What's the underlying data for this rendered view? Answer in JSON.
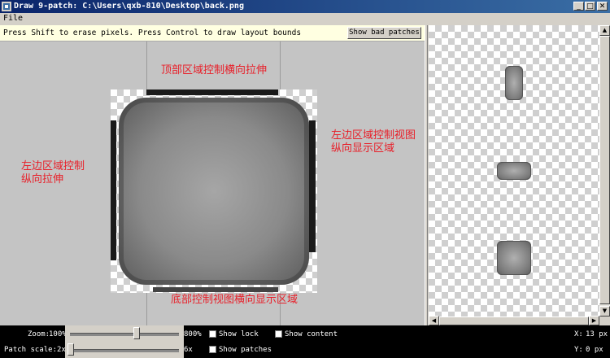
{
  "window": {
    "title": "Draw 9-patch: C:\\Users\\qxb-810\\Desktop\\back.png"
  },
  "controls": {
    "minimize": "_",
    "maximize": "□",
    "close": "✕"
  },
  "menu": {
    "items": [
      "File"
    ]
  },
  "hint": {
    "text": "Press Shift to erase pixels. Press Control to draw layout bounds"
  },
  "toolbar": {
    "show_bad_patches": "Show bad patches"
  },
  "annotations": {
    "top": "顶部区域控制横向拉伸",
    "left_line1": "左边区域控制",
    "left_line2": "纵向拉伸",
    "right_line1": "左边区域控制视图",
    "right_line2": "纵向显示区域",
    "bottom": "底部控制视图横向显示区域"
  },
  "footer": {
    "zoom_label": "Zoom:",
    "zoom_min": "100%",
    "zoom_max": "800%",
    "zoom_level": 0.61,
    "patch_scale_label": "Patch scale:",
    "patch_min": "2x",
    "patch_max": "6x",
    "patch_level": 0.02,
    "show_lock": "Show lock",
    "show_content": "Show content",
    "show_patches": "Show patches",
    "x_label": "X:",
    "x_value": "13 px",
    "y_label": "Y:",
    "y_value": "0 px"
  },
  "colors": {
    "title_bar": "#0a246a",
    "annotation": "#e8202a",
    "patch_marker": "#1a1a1a",
    "hint_background": "#ffffe1"
  },
  "icons": [
    "app-icon",
    "minimize-icon",
    "maximize-icon",
    "close-icon",
    "scroll-up-icon",
    "scroll-down-icon",
    "scroll-left-icon",
    "scroll-right-icon"
  ]
}
